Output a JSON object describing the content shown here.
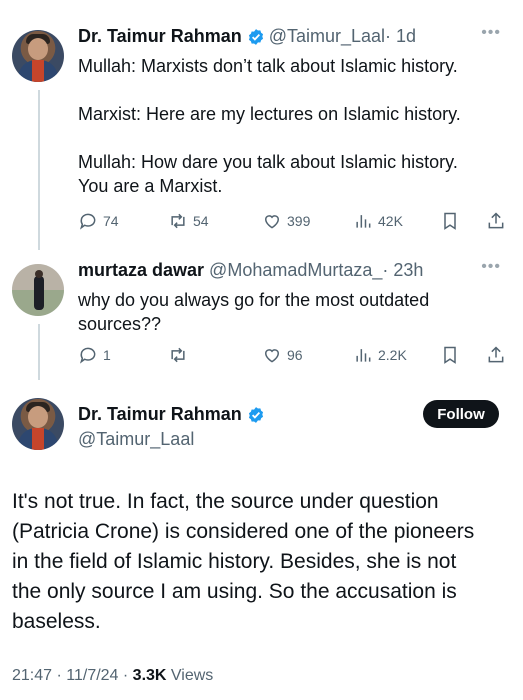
{
  "tweet1": {
    "name": "Dr. Taimur Rahman",
    "handle": "@Taimur_Laal",
    "time": " · 1d",
    "text": "Mullah: Marxists don’t talk about Islamic history.\n\nMarxist: Here are my lectures on Islamic history.\n\nMullah: How dare you talk about Islamic history.\nYou are a Marxist.",
    "replies": "74",
    "retweets": "54",
    "likes": "399",
    "views": "42K"
  },
  "tweet2": {
    "name": "murtaza dawar",
    "handle": "@MohamadMurtaza_",
    "time": " · 23h",
    "text": "why do you always go for the most outdated\nsources??",
    "replies": "1",
    "retweets": "",
    "likes": "96",
    "views": "2.2K"
  },
  "main_tweet": {
    "name": "Dr. Taimur Rahman",
    "handle": "@Taimur_Laal",
    "follow_label": "Follow",
    "text": "It's not true. In fact, the source under question\n(Patricia Crone) is considered one of the pioneers\nin the field of Islamic history. Besides, she is not\nthe only source I am using. So the accusation is\nbaseless.",
    "timestamp": "21:47 · 11/7/24 · ",
    "views_count": "3.3K",
    "views_label": " Views"
  },
  "icons": {
    "more": "more-dots-icon",
    "verified": "verified-badge-icon",
    "reply": "reply-icon",
    "retweet": "retweet-icon",
    "like": "heart-icon",
    "views": "views-bars-icon",
    "bookmark": "bookmark-icon",
    "share": "share-icon"
  },
  "colors": {
    "verified_blue": "#1d9bf0",
    "secondary_text": "#536471",
    "primary_text": "#0f1419",
    "thread_line": "#cfd9de"
  }
}
